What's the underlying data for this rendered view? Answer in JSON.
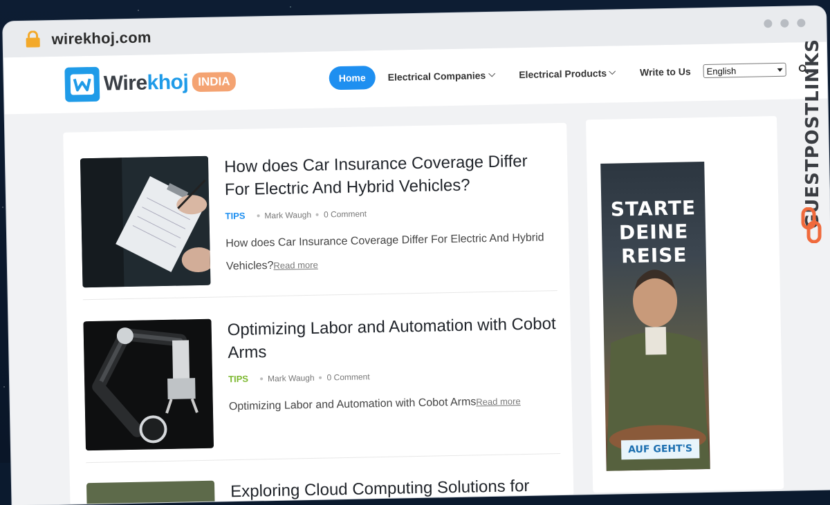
{
  "browser": {
    "url": "wirekhoj.com"
  },
  "header": {
    "logo": {
      "main": "Wire",
      "accent": "khoj",
      "badge": "INDIA",
      "mark": "w"
    },
    "nav": [
      {
        "label": "Home",
        "active": true
      },
      {
        "label": "Electrical Companies",
        "dropdown": true
      },
      {
        "label": "Electrical Products",
        "dropdown": true
      },
      {
        "label": "Write to Us",
        "dropdown": false
      }
    ],
    "language": "English",
    "search_icon": "search-icon"
  },
  "posts": [
    {
      "title": "How does Car Insurance Coverage Differ For Electric And Hybrid Vehicles?",
      "tag": "TIPS",
      "tag_color": "#1e8ff0",
      "author": "Mark Waugh",
      "comments": "0 Comment",
      "excerpt": "How does Car Insurance Coverage Differ For Electric And Hybrid Vehicles?",
      "read_more": "Read more"
    },
    {
      "title": "Optimizing Labor and Automation with Cobot Arms",
      "tag": "TIPS",
      "tag_color": "#7cb82f",
      "author": "Mark Waugh",
      "comments": "0 Comment",
      "excerpt": "Optimizing Labor and Automation with Cobot Arms",
      "read_more": "Read more"
    },
    {
      "title": "Exploring Cloud Computing Solutions for"
    }
  ],
  "sidebar_ad": {
    "headline": [
      "STARTE",
      "DEINE",
      "REISE"
    ],
    "cta": "AUF GEHT'S"
  },
  "watermark": "GUESTPOSTLINKS"
}
